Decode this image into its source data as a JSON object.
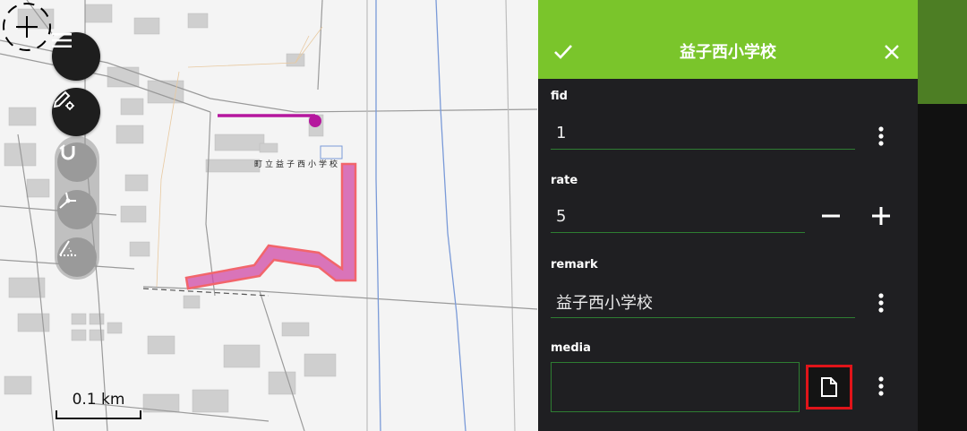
{
  "map": {
    "building_label": "町立益子西小学校",
    "scale_label": "0.1 km",
    "colors": {
      "line_feature": "#b5179e",
      "polygon_fill": "#d04aa6",
      "polygon_stroke": "#f2656b"
    }
  },
  "toolbar": {
    "menu_icon": "hamburger-menu-icon",
    "digitize_icon": "pencil-settings-icon",
    "snap_icon": "magnet-icon",
    "vertex_icon": "vertex-edit-icon",
    "measure_icon": "measure-angle-icon"
  },
  "form": {
    "title": "益子西小学校",
    "confirm_icon": "check-icon",
    "close_icon": "close-icon",
    "header_color": "#7ac52b",
    "fields": {
      "fid": {
        "label": "fid",
        "value": "1"
      },
      "rate": {
        "label": "rate",
        "value": "5",
        "decrement": "−",
        "increment": "+"
      },
      "remark": {
        "label": "remark",
        "value": "益子西小学校"
      },
      "media": {
        "label": "media",
        "value": ""
      }
    }
  }
}
